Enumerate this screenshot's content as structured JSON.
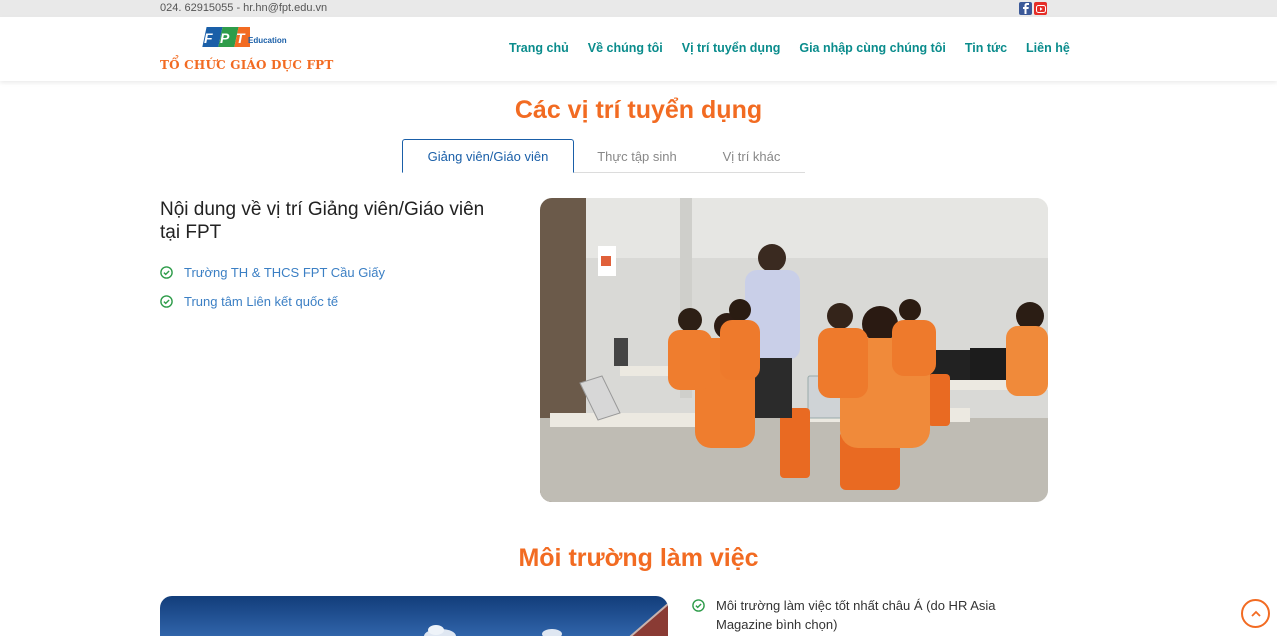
{
  "topbar": {
    "contact": "024. 62915055 - hr.hn@fpt.edu.vn",
    "socials": [
      "facebook-icon",
      "youtube-icon"
    ]
  },
  "logo": {
    "brand": "FPT",
    "sub": "Education",
    "org": "TỔ CHỨC GIÁO DỤC FPT"
  },
  "nav": {
    "items": [
      "Trang chủ",
      "Về chúng tôi",
      "Vị trí tuyển dụng",
      "Gia nhập cùng chúng tôi",
      "Tin tức",
      "Liên hệ"
    ]
  },
  "positions": {
    "title": "Các vị trí tuyển dụng",
    "tabs": [
      "Giảng viên/Giáo viên",
      "Thực tập sinh",
      "Vị trí khác"
    ],
    "active_tab": "Giảng viên/Giáo viên",
    "content_title": "Nội dung về vị trí Giảng viên/Giáo viên tại FPT",
    "links": [
      "Trường TH & THCS FPT Cầu Giấy",
      "Trung tâm Liên kết quốc tế"
    ]
  },
  "environment": {
    "title": "Môi trường làm việc",
    "items": [
      "Môi trường làm việc tốt nhất châu Á (do HR Asia Magazine bình chọn)"
    ]
  },
  "colors": {
    "accent": "#f26b22",
    "nav": "#0a8c8c",
    "link": "#3b7fc4",
    "check": "#2e9c4a"
  }
}
